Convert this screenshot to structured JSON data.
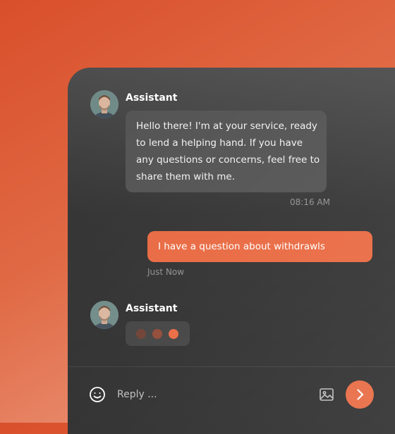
{
  "chat": {
    "messages": [
      {
        "sender": "Assistant",
        "text": "Hello there! I'm at your service, ready to lend a helping hand. If you have any questions or concerns, feel free to share them with me.",
        "time": "08:16 AM"
      },
      {
        "sender": "user",
        "text": "I have a question about withdrawls",
        "time": "Just Now"
      }
    ],
    "typing": {
      "sender": "Assistant",
      "dot_colors": [
        "#6b3a2e",
        "#8f4430",
        "#e8653c"
      ]
    }
  },
  "composer": {
    "placeholder": "Reply ...",
    "emoji_icon": "smiley-icon",
    "image_icon": "image-icon",
    "send_icon": "chevron-right-icon"
  },
  "colors": {
    "accent": "#e8653c",
    "panel": "#2e2e2e",
    "assistant_bubble": "#4f4f4f"
  }
}
